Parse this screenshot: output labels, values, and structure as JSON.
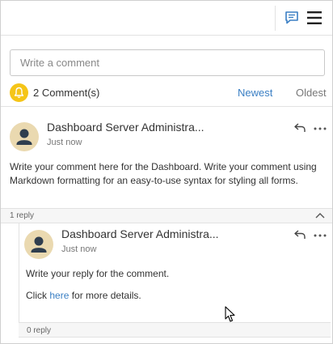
{
  "header": {
    "chat_icon": "chat-bubble-icon",
    "menu_icon": "hamburger-menu-icon"
  },
  "composer": {
    "placeholder": "Write a comment"
  },
  "summary": {
    "count_label": "2 Comment(s)",
    "sort_newest": "Newest",
    "sort_oldest": "Oldest",
    "accent_color": "#3a7fc4",
    "bell_color": "#f5c518"
  },
  "comment": {
    "author": "Dashboard Server Administra...",
    "time": "Just now",
    "text": "Write your comment here for the Dashboard. Write your comment using Markdown formatting for an easy-to-use syntax for styling all forms.",
    "replies_label": "1 reply"
  },
  "reply": {
    "author": "Dashboard Server Administra...",
    "time": "Just now",
    "line1": "Write your reply for the comment.",
    "line2_prefix": "Click",
    "line2_link": "here",
    "line2_suffix": "for more details.",
    "replies_label": "0 reply"
  }
}
